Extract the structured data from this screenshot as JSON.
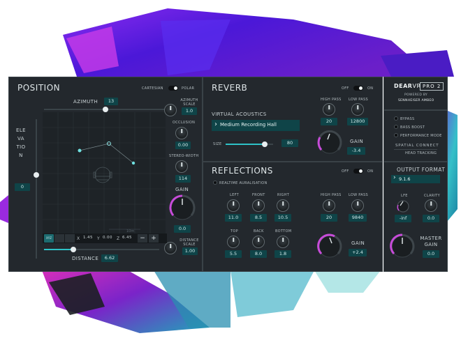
{
  "position": {
    "title": "POSITION",
    "mode_left": "CARTESIAN",
    "mode_right": "POLAR",
    "azimuth_label": "AZIMUTH",
    "azimuth_value": "13",
    "elevation_label": "ELEVATION",
    "elevation_value": "0",
    "azimuth_scale_label": "AZIMUTH SCALE",
    "azimuth_scale_value": "1.0",
    "occlusion_label": "OCCLUSION",
    "occlusion_value": "0.00",
    "stereo_width_label": "STEREO-WIDTH",
    "stereo_width_value": "114",
    "gain_label": "GAIN",
    "gain_value": "0.0",
    "distance_scale_label": "DISTANCE SCALE",
    "distance_scale_value": "1.00",
    "distance_label": "DISTANCE",
    "distance_value": "6.62",
    "grid_ruler": "10m",
    "coord_x_label": "X",
    "coord_x_value": "1.45",
    "coord_y_label": "Y",
    "coord_y_value": "0.00",
    "coord_z_label": "Z",
    "coord_z_value": "6.45",
    "minus_label": "−",
    "plus_label": "+",
    "view_tab_1": "XYZ"
  },
  "reverb": {
    "title": "REVERB",
    "off": "OFF",
    "on": "ON",
    "high_pass_label": "HIGH PASS",
    "high_pass_value": "20",
    "low_pass_label": "LOW PASS",
    "low_pass_value": "12800",
    "virtual_acoustics_label": "VIRTUAL ACOUSTICS",
    "preset": "Medium Recording Hall",
    "size_label": "SIZE",
    "size_value": "80",
    "size_fraction": 0.8,
    "gain_label": "GAIN",
    "gain_value": "-3.4"
  },
  "reflections": {
    "title": "REFLECTIONS",
    "off": "OFF",
    "on": "ON",
    "realtime_label": "REALTIME AURALISATION",
    "left_label": "LEFT",
    "left_value": "11.0",
    "front_label": "FRONT",
    "front_value": "8.5",
    "right_label": "RIGHT",
    "right_value": "10.5",
    "top_label": "TOP",
    "top_value": "5.5",
    "back_label": "BACK",
    "back_value": "8.0",
    "bottom_label": "BOTTOM",
    "bottom_value": "1.8",
    "high_pass_label": "HIGH PASS",
    "high_pass_value": "20",
    "low_pass_label": "LOW PASS",
    "low_pass_value": "9840",
    "gain_label": "GAIN",
    "gain_value": "+2.4"
  },
  "brand": {
    "dear": "DEAR",
    "vr": "VR",
    "pro": "PRO 2",
    "powered_by": "POWERED BY",
    "sennheiser": "SENNHEISER AMBEO"
  },
  "options": {
    "bypass": "BYPASS",
    "bass_boost": "BASS BOOST",
    "performance_mode": "PERFORMANCE MODE",
    "spatial_connect": "SPATIAL CONNECT",
    "head_tracking": "HEAD TRACKING"
  },
  "output": {
    "title": "OUTPUT FORMAT",
    "format": "9.1.6",
    "lfe_label": "LFE",
    "lfe_value": "-inf",
    "clarity_label": "CLARITY",
    "clarity_value": "0.0",
    "master_gain_label": "MASTER GAIN",
    "master_gain_value": "0.0"
  },
  "colors": {
    "accent": "#2ec2c7",
    "gain_arc": "#c74bd9",
    "panel": "#23282d",
    "value_box": "#0f4448"
  }
}
